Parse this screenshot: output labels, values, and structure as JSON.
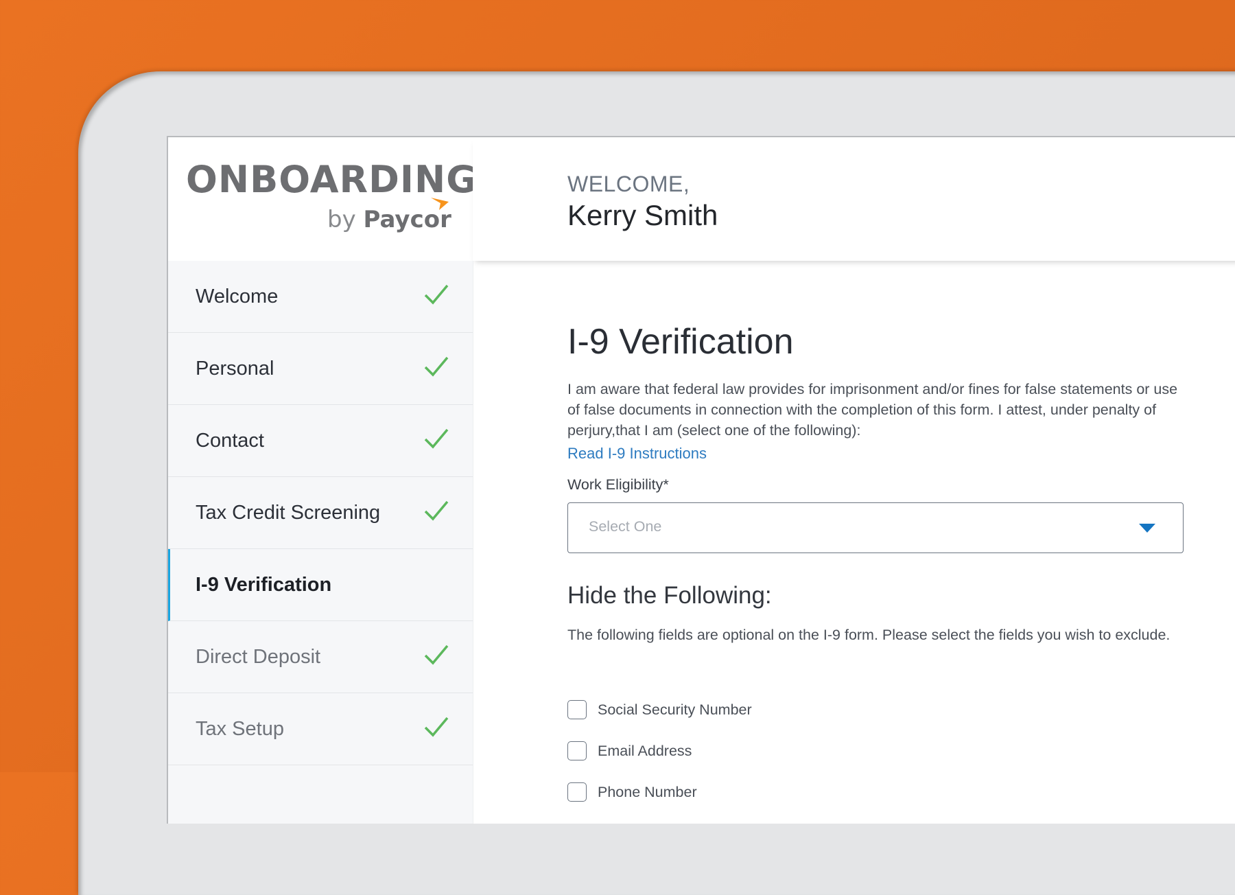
{
  "app": {
    "logo_title": "ONBOARDING",
    "logo_by": "by",
    "logo_brand": "Paycor",
    "brand_accent_color": "#f7941d"
  },
  "header": {
    "welcome_label": "WELCOME,",
    "user_name": "Kerry Smith"
  },
  "sidebar": {
    "items": [
      {
        "label": "Welcome",
        "status": "complete"
      },
      {
        "label": "Personal",
        "status": "complete"
      },
      {
        "label": "Contact",
        "status": "complete"
      },
      {
        "label": "Tax Credit Screening",
        "status": "complete"
      },
      {
        "label": "I-9 Verification",
        "status": "active"
      },
      {
        "label": "Direct Deposit",
        "status": "complete"
      },
      {
        "label": "Tax Setup",
        "status": "complete"
      }
    ],
    "active_indicator_color": "#19a5e0",
    "check_color": "#5cb85c"
  },
  "main": {
    "title": "I-9 Verification",
    "intro": "I am aware that federal law provides for imprisonment and/or fines for false statements or use of false documents in connection with the completion of this form. I attest, under penalty of perjury,that I am (select one of the following):",
    "instructions_link": "Read I-9 Instructions",
    "work_eligibility": {
      "label": "Work Eligibility*",
      "placeholder": "Select One",
      "value": ""
    },
    "hide_section": {
      "title": "Hide the Following:",
      "description": "The following fields are optional on the I-9 form. Please select the fields you wish to exclude.",
      "options": [
        {
          "label": "Social Security Number",
          "checked": false
        },
        {
          "label": "Email Address",
          "checked": false
        },
        {
          "label": "Phone Number",
          "checked": false
        }
      ]
    }
  }
}
